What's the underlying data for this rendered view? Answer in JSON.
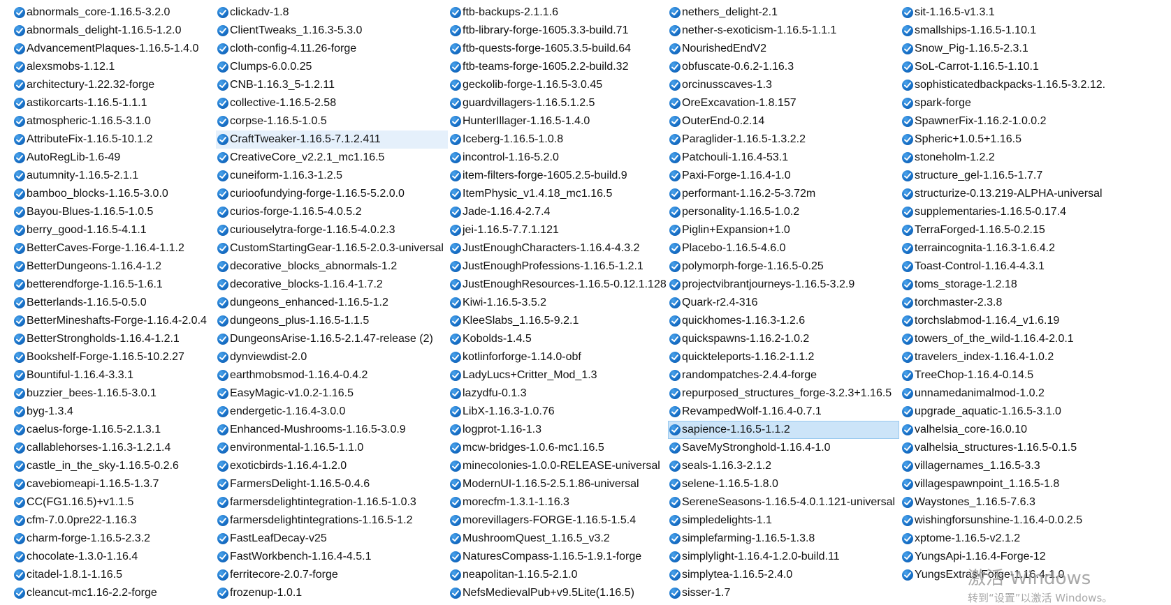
{
  "icon_name": "jar-file-icon",
  "accent_color": "#1a73c9",
  "selected_color": "#cce4f8",
  "columns": [
    {
      "items": [
        "abnormals_core-1.16.5-3.2.0",
        "abnormals_delight-1.16.5-1.2.0",
        "AdvancementPlaques-1.16.5-1.4.0",
        "alexsmobs-1.12.1",
        "architectury-1.22.32-forge",
        "astikorcarts-1.16.5-1.1.1",
        "atmospheric-1.16.5-3.1.0",
        "AttributeFix-1.16.5-10.1.2",
        "AutoRegLib-1.6-49",
        "autumnity-1.16.5-2.1.1",
        "bamboo_blocks-1.16.5-3.0.0",
        "Bayou-Blues-1.16.5-1.0.5",
        "berry_good-1.16.5-4.1.1",
        "BetterCaves-Forge-1.16.4-1.1.2",
        "BetterDungeons-1.16.4-1.2",
        "betterendforge-1.16.5-1.6.1",
        "Betterlands-1.16.5-0.5.0",
        "BetterMineshafts-Forge-1.16.4-2.0.4",
        "BetterStrongholds-1.16.4-1.2.1",
        "Bookshelf-Forge-1.16.5-10.2.27",
        "Bountiful-1.16.4-3.3.1",
        "buzzier_bees-1.16.5-3.0.1",
        "byg-1.3.4",
        "caelus-forge-1.16.5-2.1.3.1",
        "callablehorses-1.16.3-1.2.1.4",
        "castle_in_the_sky-1.16.5-0.2.6",
        "cavebiomeapi-1.16.5-1.3.7",
        "CC(FG1.16.5)+v1.1.5",
        "cfm-7.0.0pre22-1.16.3",
        "charm-forge-1.16.5-2.3.2",
        "chocolate-1.3.0-1.16.4",
        "citadel-1.8.1-1.16.5",
        "cleancut-mc1.16-2.2-forge"
      ]
    },
    {
      "items": [
        "clickadv-1.8",
        "ClientTweaks_1.16.3-5.3.0",
        "cloth-config-4.11.26-forge",
        "Clumps-6.0.0.25",
        "CNB-1.16.3_5-1.2.11",
        "collective-1.16.5-2.58",
        "corpse-1.16.5-1.0.5",
        "CraftTweaker-1.16.5-7.1.2.411",
        "CreativeCore_v2.2.1_mc1.16.5",
        "cuneiform-1.16.3-1.2.5",
        "curioofundying-forge-1.16.5-5.2.0.0",
        "curios-forge-1.16.5-4.0.5.2",
        "curiouselytra-forge-1.16.5-4.0.2.3",
        "CustomStartingGear-1.16.5-2.0.3-universal",
        "decorative_blocks_abnormals-1.2",
        "decorative_blocks-1.16.4-1.7.2",
        "dungeons_enhanced-1.16.5-1.2",
        "dungeons_plus-1.16.5-1.1.5",
        "DungeonsArise-1.16.5-2.1.47-release (2)",
        "dynviewdist-2.0",
        "earthmobsmod-1.16.4-0.4.2",
        "EasyMagic-v1.0.2-1.16.5",
        "endergetic-1.16.4-3.0.0",
        "Enhanced-Mushrooms-1.16.5-3.0.9",
        "environmental-1.16.5-1.1.0",
        "exoticbirds-1.16.4-1.2.0",
        "FarmersDelight-1.16.5-0.4.6",
        "farmersdelightintegration-1.16.5-1.0.3",
        "farmersdelightintegrations-1.16.5-1.2",
        "FastLeafDecay-v25",
        "FastWorkbench-1.16.4-4.5.1",
        "ferritecore-2.0.7-forge",
        "frozenup-1.0.1"
      ]
    },
    {
      "items": [
        "ftb-backups-2.1.1.6",
        "ftb-library-forge-1605.3.3-build.71",
        "ftb-quests-forge-1605.3.5-build.64",
        "ftb-teams-forge-1605.2.2-build.32",
        "geckolib-forge-1.16.5-3.0.45",
        "guardvillagers-1.16.5.1.2.5",
        "HunterIllager-1.16.5-1.4.0",
        "Iceberg-1.16.5-1.0.8",
        "incontrol-1.16-5.2.0",
        "item-filters-forge-1605.2.5-build.9",
        "ItemPhysic_v1.4.18_mc1.16.5",
        "Jade-1.16.4-2.7.4",
        "jei-1.16.5-7.7.1.121",
        "JustEnoughCharacters-1.16.4-4.3.2",
        "JustEnoughProfessions-1.16.5-1.2.1",
        "JustEnoughResources-1.16.5-0.12.1.128",
        "Kiwi-1.16.5-3.5.2",
        "KleeSlabs_1.16.5-9.2.1",
        "Kobolds-1.4.5",
        "kotlinforforge-1.14.0-obf",
        "LadyLucs+Critter_Mod_1.3",
        "lazydfu-0.1.3",
        "LibX-1.16.3-1.0.76",
        "logprot-1.16-1.3",
        "mcw-bridges-1.0.6-mc1.16.5",
        "minecolonies-1.0.0-RELEASE-universal",
        "ModernUI-1.16.5-2.5.1.86-universal",
        "morecfm-1.3.1-1.16.3",
        "morevillagers-FORGE-1.16.5-1.5.4",
        "MushroomQuest_1.16.5_v3.2",
        "NaturesCompass-1.16.5-1.9.1-forge",
        "neapolitan-1.16.5-2.1.0",
        "NefsMedievalPub+v9.5Lite(1.16.5)"
      ]
    },
    {
      "items": [
        "nethers_delight-2.1",
        "nether-s-exoticism-1.16.5-1.1.1",
        "NourishedEndV2",
        "obfuscate-0.6.2-1.16.3",
        "orcinusscaves-1.3",
        "OreExcavation-1.8.157",
        "OuterEnd-0.2.14",
        "Paraglider-1.16.5-1.3.2.2",
        "Patchouli-1.16.4-53.1",
        "Paxi-Forge-1.16.4-1.0",
        "performant-1.16.2-5-3.72m",
        "personality-1.16.5-1.0.2",
        "Piglin+Expansion+1.0",
        "Placebo-1.16.5-4.6.0",
        "polymorph-forge-1.16.5-0.25",
        "projectvibrantjourneys-1.16.5-3.2.9",
        "Quark-r2.4-316",
        "quickhomes-1.16.3-1.2.6",
        "quickspawns-1.16.2-1.0.2",
        "quickteleports-1.16.2-1.1.2",
        "randompatches-2.4.4-forge",
        "repurposed_structures_forge-3.2.3+1.16.5",
        "RevampedWolf-1.16.4-0.7.1",
        "sapience-1.16.5-1.1.2",
        "SaveMyStronghold-1.16.4-1.0",
        "seals-1.16.3-2.1.2",
        "selene-1.16.5-1.8.0",
        "SereneSeasons-1.16.5-4.0.1.121-universal",
        "simpledelights-1.1",
        "simplefarming-1.16.5-1.3.8",
        "simplylight-1.16.4-1.2.0-build.11",
        "simplytea-1.16.5-2.4.0",
        "sisser-1.7"
      ]
    },
    {
      "items": [
        "sit-1.16.5-v1.3.1",
        "smallships-1.16.5-1.10.1",
        "Snow_Pig-1.16.5-2.3.1",
        "SoL-Carrot-1.16.5-1.10.1",
        "sophisticatedbackpacks-1.16.5-3.2.12.",
        "spark-forge",
        "SpawnerFix-1.16.2-1.0.0.2",
        "Spheric+1.0.5+1.16.5",
        "stoneholm-1.2.2",
        "structure_gel-1.16.5-1.7.7",
        "structurize-0.13.219-ALPHA-universal",
        "supplementaries-1.16.5-0.17.4",
        "TerraForged-1.16.5-0.2.15",
        "terraincognita-1.16.3-1.6.4.2",
        "Toast-Control-1.16.4-4.3.1",
        "toms_storage-1.2.18",
        "torchmaster-2.3.8",
        "torchslabmod-1.16.4_v1.6.19",
        "towers_of_the_wild-1.16.4-2.0.1",
        "travelers_index-1.16.4-1.0.2",
        "TreeChop-1.16.4-0.14.5",
        "unnamedanimalmod-1.0.2",
        "upgrade_aquatic-1.16.5-3.1.0",
        "valhelsia_core-16.0.10",
        "valhelsia_structures-1.16.5-0.1.5",
        "villagernames_1.16.5-3.3",
        "villagespawnpoint_1.16.5-1.8",
        "Waystones_1.16.5-7.6.3",
        "wishingforsunshine-1.16.4-0.0.2.5",
        "xptome-1.16.5-v2.1.2",
        "YungsApi-1.16.4-Forge-12",
        "YungsExtras-Forge-1.16.4-1.0"
      ]
    }
  ],
  "selection": {
    "hovered": "CraftTweaker-1.16.5-7.1.2.411",
    "selected": "sapience-1.16.5-1.1.2"
  },
  "watermark": {
    "line1": "激活 Windows",
    "line2": "转到“设置”以激活 Windows。"
  }
}
